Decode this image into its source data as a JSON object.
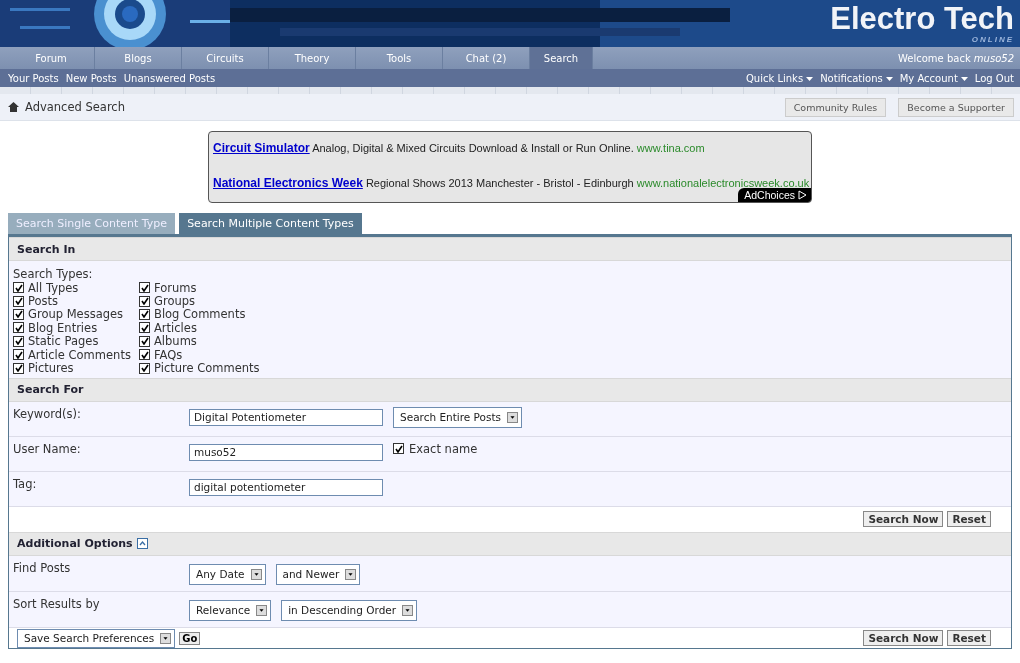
{
  "header": {
    "logo": "Electro Tech",
    "logo_sub": "ONLINE"
  },
  "nav_tabs": [
    {
      "label": "Forum",
      "selected": false
    },
    {
      "label": "Blogs",
      "selected": false
    },
    {
      "label": "Circuits",
      "selected": false
    },
    {
      "label": "Theory",
      "selected": false
    },
    {
      "label": "Tools",
      "selected": false
    },
    {
      "label": "Chat (2)",
      "selected": false
    },
    {
      "label": "Search",
      "selected": true
    }
  ],
  "welcome": {
    "text": "Welcome back",
    "user": "muso52"
  },
  "sub_links": [
    "Your Posts",
    "New Posts",
    "Unanswered Posts"
  ],
  "menus": [
    {
      "label": "Quick Links",
      "kind": "menu"
    },
    {
      "label": "Notifications",
      "kind": "menu"
    },
    {
      "label": "My Account",
      "kind": "menu"
    },
    {
      "label": "Log Out",
      "kind": "link"
    }
  ],
  "breadcrumb": "Advanced Search",
  "header_buttons": [
    "Community Rules",
    "Become a Supporter"
  ],
  "ads": [
    {
      "title": "Circuit Simulator",
      "text": "Analog, Digital & Mixed Circuits Download & Install or Run Online.",
      "url": "www.tina.com"
    },
    {
      "title": "National Electronics Week",
      "text": "Regional Shows 2013 Manchester - Bristol - Edinburgh",
      "url": "www.nationalelectronicsweek.co.uk"
    }
  ],
  "ad_choices": "AdChoices",
  "search_tabs": [
    {
      "label": "Search Single Content Type",
      "selected": false
    },
    {
      "label": "Search Multiple Content Types",
      "selected": true
    }
  ],
  "search_in": {
    "heading": "Search In",
    "label": "Search Types:",
    "columns": [
      [
        {
          "label": "All Types",
          "checked": true
        },
        {
          "label": "Posts",
          "checked": true
        },
        {
          "label": "Group Messages",
          "checked": true
        },
        {
          "label": "Blog Entries",
          "checked": true
        },
        {
          "label": "Static Pages",
          "checked": true
        },
        {
          "label": "Article Comments",
          "checked": true
        },
        {
          "label": "Pictures",
          "checked": true
        }
      ],
      [
        {
          "label": "Forums",
          "checked": true
        },
        {
          "label": "Groups",
          "checked": true
        },
        {
          "label": "Blog Comments",
          "checked": true
        },
        {
          "label": "Articles",
          "checked": true
        },
        {
          "label": "Albums",
          "checked": true
        },
        {
          "label": "FAQs",
          "checked": true
        },
        {
          "label": "Picture Comments",
          "checked": true
        }
      ]
    ]
  },
  "search_for": {
    "heading": "Search For",
    "rows": [
      {
        "label": "Keyword(s):",
        "value": "Digital Potentiometer",
        "extra": {
          "kind": "select",
          "label": "Search Entire Posts"
        }
      },
      {
        "label": "User Name:",
        "value": "muso52",
        "extra": {
          "kind": "checkbox",
          "label": "Exact name",
          "checked": true
        }
      },
      {
        "label": "Tag:",
        "value": "digital potentiometer"
      }
    ],
    "buttons": [
      "Search Now",
      "Reset"
    ]
  },
  "additional": {
    "heading": "Additional Options",
    "expanded": true,
    "rows": [
      {
        "label": "Find Posts",
        "selects": [
          "Any Date",
          "and Newer"
        ]
      },
      {
        "label": "Sort Results by",
        "selects": [
          "Relevance",
          "in Descending Order"
        ]
      }
    ]
  },
  "footer": {
    "select": "Save Search Preferences",
    "go": "Go",
    "buttons": [
      "Search Now",
      "Reset"
    ]
  }
}
